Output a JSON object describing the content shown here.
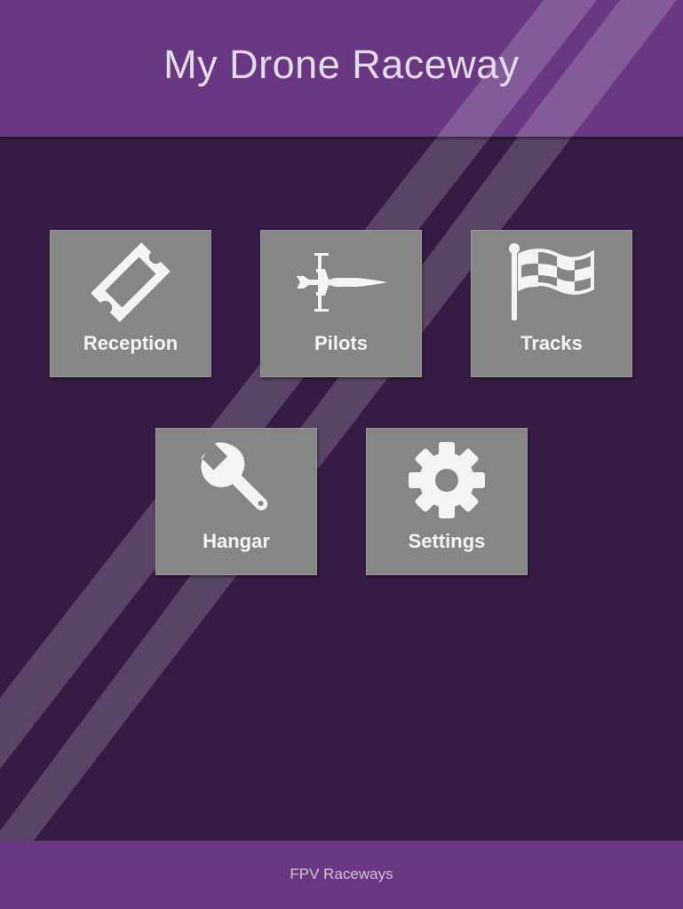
{
  "header": {
    "title": "My Drone Raceway"
  },
  "menu": {
    "tiles": [
      {
        "label": "Reception",
        "icon": "ticket-icon"
      },
      {
        "label": "Pilots",
        "icon": "fighter-jet-icon"
      },
      {
        "label": "Tracks",
        "icon": "checkered-flag-icon"
      },
      {
        "label": "Hangar",
        "icon": "wrench-icon"
      },
      {
        "label": "Settings",
        "icon": "gear-icon"
      }
    ]
  },
  "footer": {
    "text": "FPV Raceways"
  },
  "colors": {
    "background": "#361c45",
    "bar": "#6a3783",
    "tile": "#868686",
    "icon": "#f4f4f4"
  }
}
